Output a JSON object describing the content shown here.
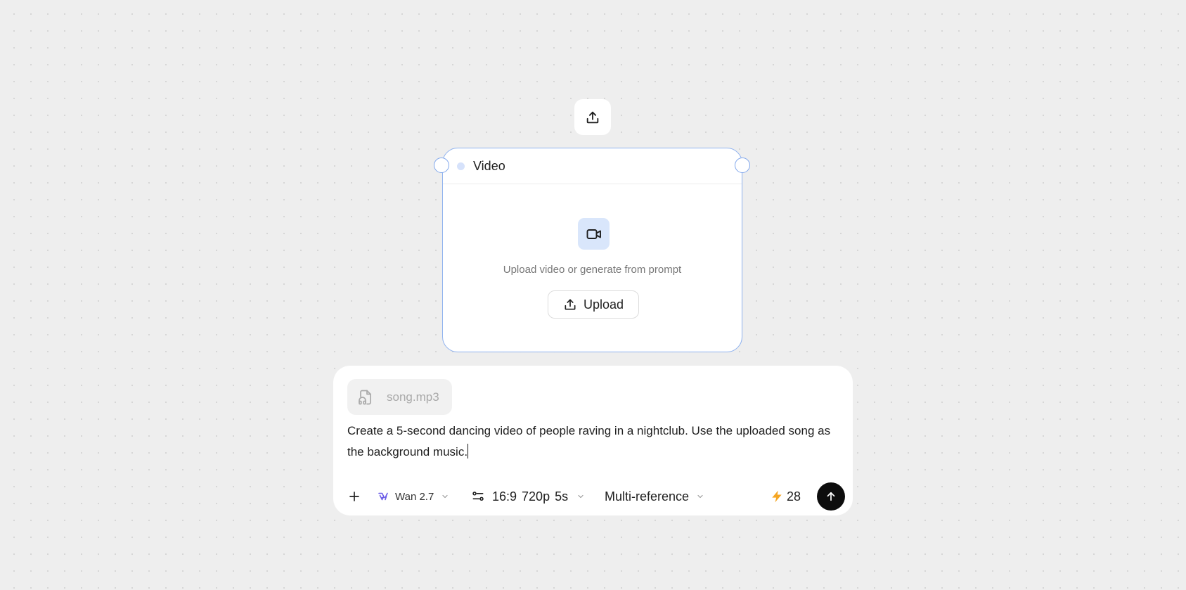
{
  "canvas": {
    "export_icon": "upload-tray-icon"
  },
  "video_node": {
    "title": "Video",
    "hint": "Upload video or generate from prompt",
    "upload_label": "Upload",
    "media_icon": "video-camera-icon",
    "accent_color": "#8fb2ef",
    "icon_bg_color": "#d9e6fb"
  },
  "prompt": {
    "attachment": {
      "filename": "song.mp3",
      "icon": "audio-file-icon"
    },
    "text": "Create a 5-second dancing video of people raving in a nightclub. Use the uploaded song as the background music.",
    "toolbar": {
      "model_label": "Wan 2.7",
      "model_icon": "wan-logo-icon",
      "settings_label": "16:9 720p 5s",
      "settings_icon": "sliders-icon",
      "mode_label": "Multi-reference",
      "credits": "28",
      "credits_icon": "lightning-icon",
      "credits_color": "#f5a623",
      "model_icon_color": "#6b5ce7"
    }
  }
}
